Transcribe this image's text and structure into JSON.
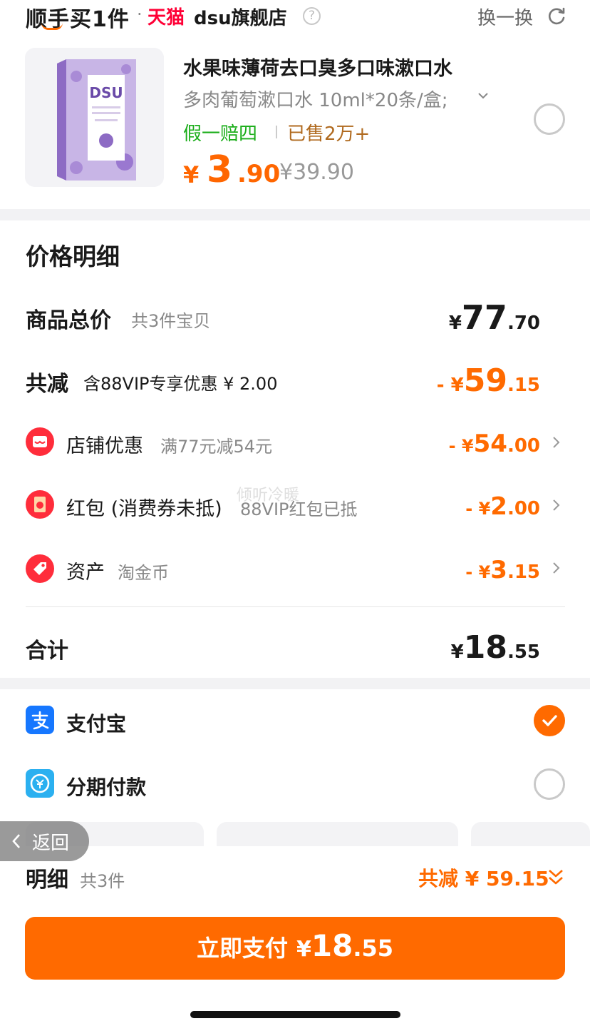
{
  "header": {
    "title": "顺手买1件",
    "separator": "·",
    "tmall": "天猫",
    "store": "dsu旗舰店",
    "help_symbol": "?",
    "swap_label": "换一换"
  },
  "product": {
    "name": "水果味薄荷去口臭多口味漱口水",
    "spec": "多肉葡萄漱口水 10ml*20条/盒;",
    "guarantee": "假一赔四",
    "sold": "已售2万+",
    "price_symbol": "¥",
    "price_int": "3",
    "price_dec": ".90",
    "original_price": "¥39.90",
    "image_brand": "DSU"
  },
  "price_detail": {
    "title": "价格明细",
    "total": {
      "label": "商品总价",
      "sub": "共3件宝贝",
      "sym": "¥",
      "int": "77",
      "dec": ".70"
    },
    "reduce": {
      "label": "共减",
      "sub": "含88VIP专享优惠 ¥ 2.00",
      "sym": "- ¥",
      "int": "59",
      "dec": ".15"
    },
    "store_discount": {
      "label": "店铺优惠",
      "sub": "满77元减54元",
      "sym": "- ¥",
      "int": "54",
      "dec": ".00"
    },
    "red_packet": {
      "label": "红包 (消费券未抵)",
      "sub": "88VIP红包已抵",
      "sym": "- ¥",
      "int": "2",
      "dec": ".00"
    },
    "assets": {
      "label": "资产",
      "sub": "淘金币",
      "sym": "- ¥",
      "int": "3",
      "dec": ".15"
    },
    "sum": {
      "label": "合计",
      "sym": "¥",
      "int": "18",
      "dec": ".55"
    }
  },
  "payment": {
    "alipay": "支付宝",
    "installment": "分期付款"
  },
  "back_label": "返回",
  "watermark": "倾听冷暖",
  "footer": {
    "detail_title": "明细",
    "detail_count": "共3件",
    "detail_saved": "共减 ¥ 59.15",
    "pay_label": "立即支付",
    "pay_sym": "¥",
    "pay_int": "18",
    "pay_dec": ".55"
  },
  "colors": {
    "accent": "#ff6a00",
    "tmall": "#ff0036",
    "alipay": "#1677ff",
    "guarantee": "#1aad19"
  }
}
